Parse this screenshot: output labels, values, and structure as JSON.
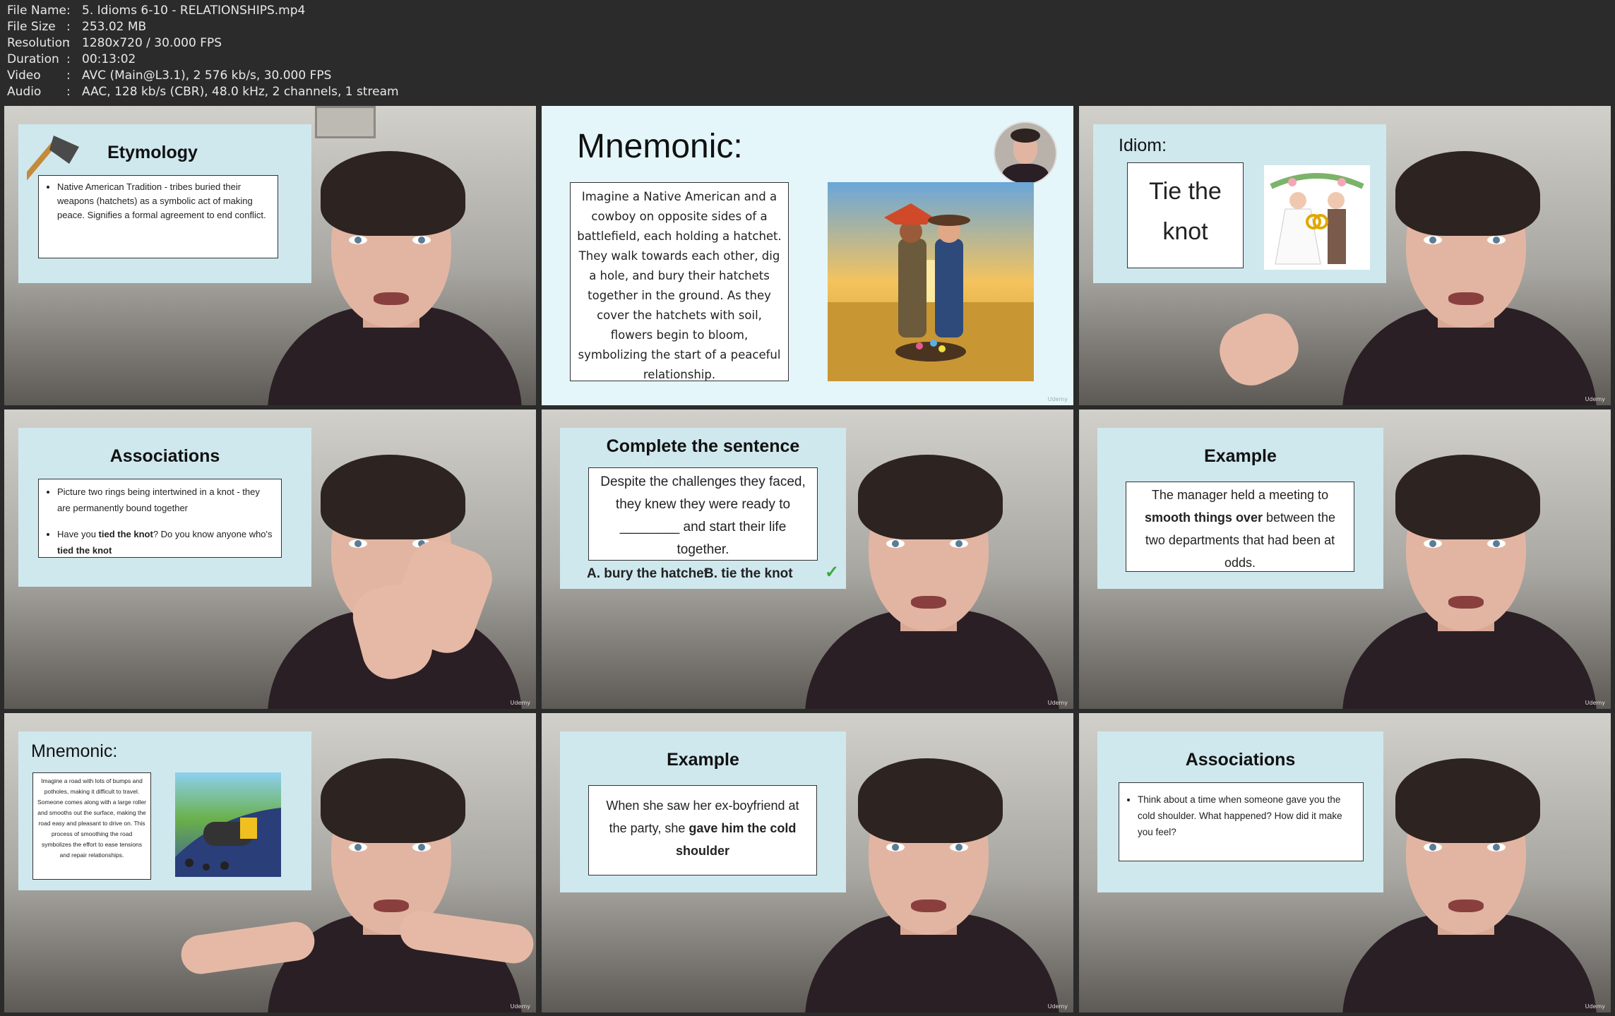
{
  "header": {
    "rows": [
      {
        "key": "File Name",
        "value": "5. Idioms 6-10 - RELATIONSHIPS.mp4"
      },
      {
        "key": "File Size",
        "value": "253.02 MB"
      },
      {
        "key": "Resolution",
        "value": "1280x720 / 30.000 FPS"
      },
      {
        "key": "Duration",
        "value": "00:13:02"
      },
      {
        "key": "Video",
        "value": "AVC (Main@L3.1), 2 576 kb/s, 30.000 FPS"
      },
      {
        "key": "Audio",
        "value": "AAC, 128 kb/s (CBR), 48.0 kHz, 2 channels, 1 stream"
      }
    ],
    "separator": ":"
  },
  "thumbs": {
    "t1": {
      "title": "Etymology",
      "bullet": "Native American Tradition - tribes buried their weapons (hatchets) as a symbolic act of making peace. Signifies a formal agreement to end conflict."
    },
    "t2": {
      "title": "Mnemonic:",
      "text": "Imagine a Native American and a cowboy on opposite sides of a battlefield, each holding a hatchet. They walk towards each other, dig a hole, and bury their hatchets together in the ground. As they cover the hatchets with soil, flowers begin to bloom, symbolizing the start of a peaceful relationship."
    },
    "t3": {
      "title": "Idiom:",
      "idiom_line1": "Tie the",
      "idiom_line2": "knot"
    },
    "t4": {
      "title": "Associations",
      "bullet1": "Picture two rings being intertwined in a knot - they are permanently bound together",
      "bullet2_pre": "Have you ",
      "bullet2_bold": "tied the knot",
      "bullet2_post": "? Do you know anyone who's ",
      "bullet2_bold2": "tied the knot"
    },
    "t5": {
      "title": "Complete the sentence",
      "text": "Despite the challenges they faced, they knew they were ready to ________ and start their life together.",
      "option_a": "A. bury the hatchet",
      "option_b": "B. tie the knot",
      "check": "✓"
    },
    "t6": {
      "title": "Example",
      "pre": "The manager held a meeting to ",
      "bold": "smooth things over",
      "post": " between the two departments that had been at odds."
    },
    "t7": {
      "title": "Mnemonic:",
      "text": "Imagine a road with lots of bumps and potholes, making it difficult to travel. Someone comes along with a large roller and smooths out the surface, making the road easy and pleasant to drive on. This process of smoothing the road symbolizes the effort to ease tensions and repair relationships."
    },
    "t8": {
      "title": "Example",
      "pre": "When she saw her ex-boyfriend at the party, she ",
      "bold": "gave him the cold shoulder"
    },
    "t9": {
      "title": "Associations",
      "bullet": "Think about a time when someone gave you the cold shoulder. What happened? How did it make you feel?"
    }
  },
  "watermark": "Udemy",
  "colors": {
    "slide_bg": "#cfe8ee",
    "check_green": "#3aa83a",
    "background": "#2b2b2b"
  }
}
